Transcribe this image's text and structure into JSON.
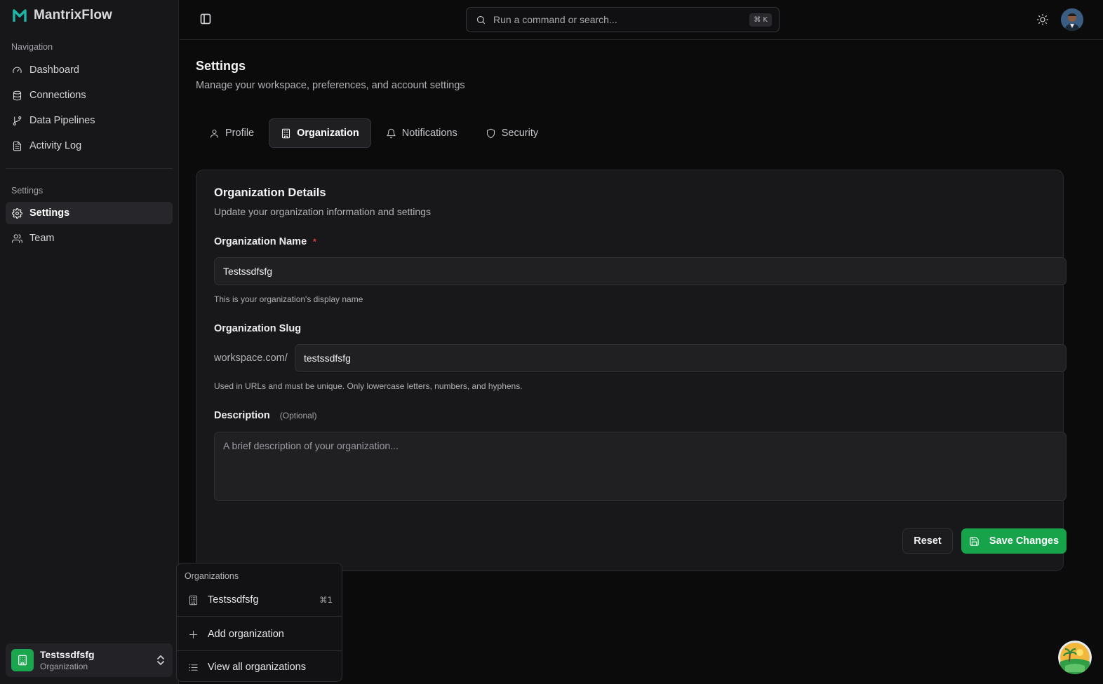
{
  "app": {
    "name": "MantrixFlow"
  },
  "sidebar": {
    "nav_section_label": "Navigation",
    "nav_items": [
      {
        "label": "Dashboard",
        "icon": "gauge-icon"
      },
      {
        "label": "Connections",
        "icon": "database-icon"
      },
      {
        "label": "Data Pipelines",
        "icon": "git-branch-icon"
      },
      {
        "label": "Activity Log",
        "icon": "file-text-icon"
      }
    ],
    "settings_section_label": "Settings",
    "settings_items": [
      {
        "label": "Settings",
        "icon": "gear-icon",
        "active": true
      },
      {
        "label": "Team",
        "icon": "users-icon"
      }
    ],
    "org_switcher": {
      "name": "Testssdfsfg",
      "subtitle": "Organization"
    }
  },
  "topbar": {
    "search_placeholder": "Run a command or search...",
    "search_shortcut": "⌘ K"
  },
  "page": {
    "title": "Settings",
    "subtitle": "Manage your workspace, preferences, and account settings"
  },
  "tabs": [
    {
      "label": "Profile",
      "icon": "user-icon"
    },
    {
      "label": "Organization",
      "icon": "building-icon",
      "active": true
    },
    {
      "label": "Notifications",
      "icon": "bell-icon"
    },
    {
      "label": "Security",
      "icon": "shield-icon"
    }
  ],
  "card": {
    "title": "Organization Details",
    "subtitle": "Update your organization information and settings",
    "org_name_label": "Organization Name",
    "org_name_required": "*",
    "org_name_value": "Testssdfsfg",
    "org_name_help": "This is your organization's display name",
    "slug_label": "Organization Slug",
    "slug_prefix": "workspace.com/",
    "slug_value": "testssdfsfg",
    "slug_help": "Used in URLs and must be unique. Only lowercase letters, numbers, and hyphens.",
    "description_label": "Description",
    "description_optional": "(Optional)",
    "description_placeholder": "A brief description of your organization...",
    "reset_label": "Reset",
    "save_label": "Save Changes"
  },
  "org_dropdown": {
    "header": "Organizations",
    "items": [
      {
        "label": "Testssdfsfg",
        "shortcut": "⌘1"
      }
    ],
    "add_label": "Add organization",
    "view_all_label": "View all organizations"
  },
  "colors": {
    "accent": "#16a34a",
    "background": "#0b0b0c",
    "sidebar": "#171719",
    "required": "#e04040"
  }
}
